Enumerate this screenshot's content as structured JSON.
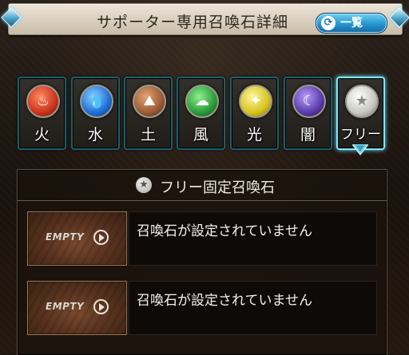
{
  "header": {
    "title": "サポーター専用召喚石詳細",
    "list_button": "一覧",
    "list_icon": "swap-arrows-icon"
  },
  "element_tabs": [
    {
      "label": "火",
      "icon": "fire-icon",
      "color": "#c9331d"
    },
    {
      "label": "水",
      "icon": "water-drops-icon",
      "color": "#1d6fd6"
    },
    {
      "label": "土",
      "icon": "earth-icon",
      "color": "#9a5a33"
    },
    {
      "label": "風",
      "icon": "wind-icon",
      "color": "#2b9a39"
    },
    {
      "label": "光",
      "icon": "light-icon",
      "color": "#d6c31d"
    },
    {
      "label": "闇",
      "icon": "dark-icon",
      "color": "#5b3aa8"
    },
    {
      "label": "フリー",
      "icon": "star-icon",
      "color": "#c8c8c0",
      "selected": true
    }
  ],
  "panel": {
    "title": "フリー固定召喚石",
    "title_icon": "star-icon",
    "slots": [
      {
        "thumb_text": "EMPTY",
        "message": "召喚石が設定されていません"
      },
      {
        "thumb_text": "EMPTY",
        "message": "召喚石が設定されていません"
      }
    ]
  }
}
